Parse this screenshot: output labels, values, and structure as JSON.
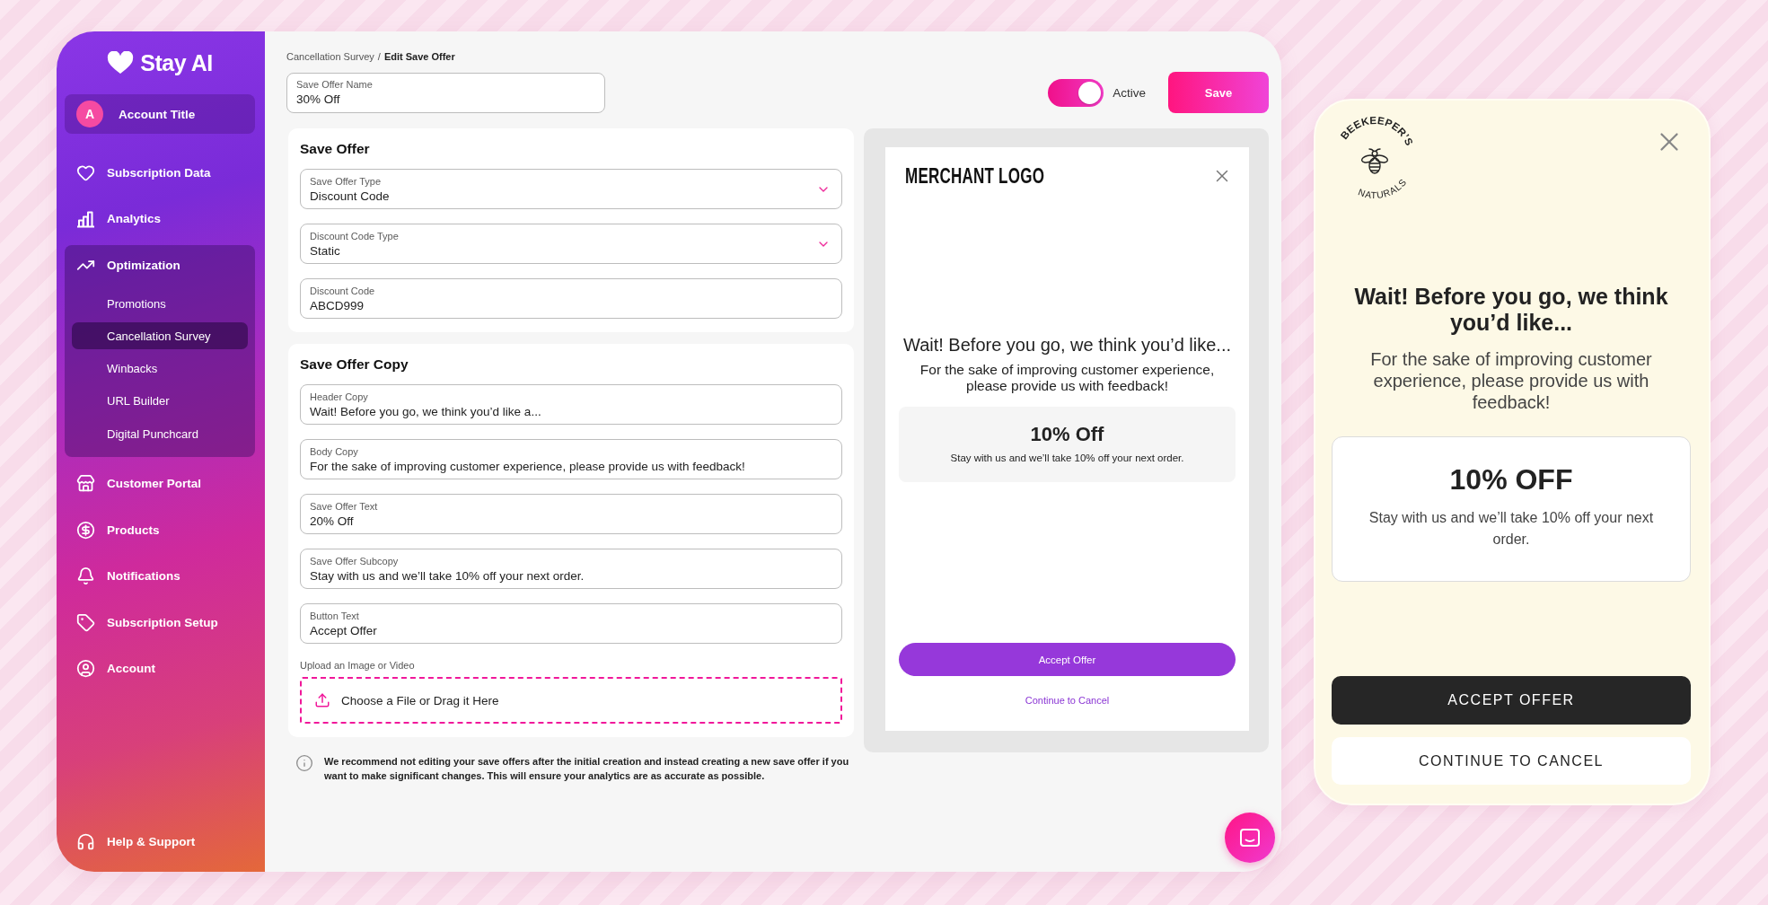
{
  "sidebar": {
    "brand": "Stay AI",
    "account": {
      "initial": "A",
      "title": "Account Title"
    },
    "items": [
      {
        "label": "Subscription Data",
        "expanded": false
      },
      {
        "label": "Analytics",
        "expanded": false
      },
      {
        "label": "Optimization",
        "expanded": true,
        "children": [
          {
            "label": "Promotions",
            "selected": false
          },
          {
            "label": "Cancellation Survey",
            "selected": true
          },
          {
            "label": "Winbacks",
            "selected": false
          },
          {
            "label": "URL Builder",
            "selected": false
          },
          {
            "label": "Digital Punchcard",
            "selected": false
          }
        ]
      },
      {
        "label": "Customer Portal",
        "expanded": false
      },
      {
        "label": "Products",
        "expanded": false
      },
      {
        "label": "Notifications",
        "expanded": false
      },
      {
        "label": "Subscription Setup",
        "expanded": false
      },
      {
        "label": "Account",
        "expanded": false
      }
    ],
    "help": {
      "label": "Help & Support"
    }
  },
  "breadcrumb": {
    "separator": "/",
    "items": [
      {
        "label": "Cancellation Survey",
        "current": false
      },
      {
        "label": "Edit Save Offer",
        "current": true
      }
    ]
  },
  "offer_name": {
    "label": "Save Offer Name",
    "value": "30% Off"
  },
  "status_toggle": {
    "on": true,
    "label": "Active"
  },
  "save_button": {
    "label": "Save"
  },
  "save_offer": {
    "title": "Save Offer",
    "fields": [
      {
        "kind": "select",
        "label": "Save Offer Type",
        "value": "Discount Code"
      },
      {
        "kind": "select",
        "label": "Discount Code Type",
        "value": "Static"
      },
      {
        "kind": "text",
        "label": "Discount Code",
        "value": "ABCD999"
      }
    ]
  },
  "save_offer_copy": {
    "title": "Save Offer Copy",
    "fields": [
      {
        "kind": "text",
        "label": "Header Copy",
        "value": "Wait! Before you go, we think you’d like a..."
      },
      {
        "kind": "text",
        "label": "Body Copy",
        "value": "For the sake of improving customer experience, please provide us with feedback!"
      },
      {
        "kind": "text",
        "label": "Save Offer Text",
        "value": "20% Off"
      },
      {
        "kind": "text",
        "label": "Save Offer Subcopy",
        "value": "Stay with us and we’ll take 10% off your next order."
      },
      {
        "kind": "text",
        "label": "Button Text",
        "value": "Accept Offer"
      }
    ],
    "upload": {
      "label": "Upload an Image or Video",
      "prompt": "Choose a File or Drag it Here"
    }
  },
  "notice": "We recommend not editing your save offers after the initial creation and instead creating a new save offer if you want to make significant changes. This will ensure your analytics are as accurate as possible.",
  "preview": {
    "logo": "MERCHANT LOGO",
    "heading": "Wait! Before you go, we think you’d like...",
    "body": "For the sake of improving customer experience, please provide us with feedback!",
    "offer_title": "10% Off",
    "offer_subcopy": "Stay with us and we’ll take 10% off your next order.",
    "accept": "Accept Offer",
    "cancel": "Continue to Cancel"
  },
  "mobile_preview": {
    "logo_top": "BEEKEEPER’S",
    "logo_bottom": "NATURALS",
    "heading": "Wait! Before you go, we think you’d like...",
    "body": "For the sake of improving customer experience, please provide us with feedback!",
    "offer_title": "10% OFF",
    "offer_subcopy": "Stay with us and we’ll take 10% off your next order.",
    "accept": "ACCEPT OFFER",
    "cancel": "CONTINUE TO CANCEL"
  }
}
